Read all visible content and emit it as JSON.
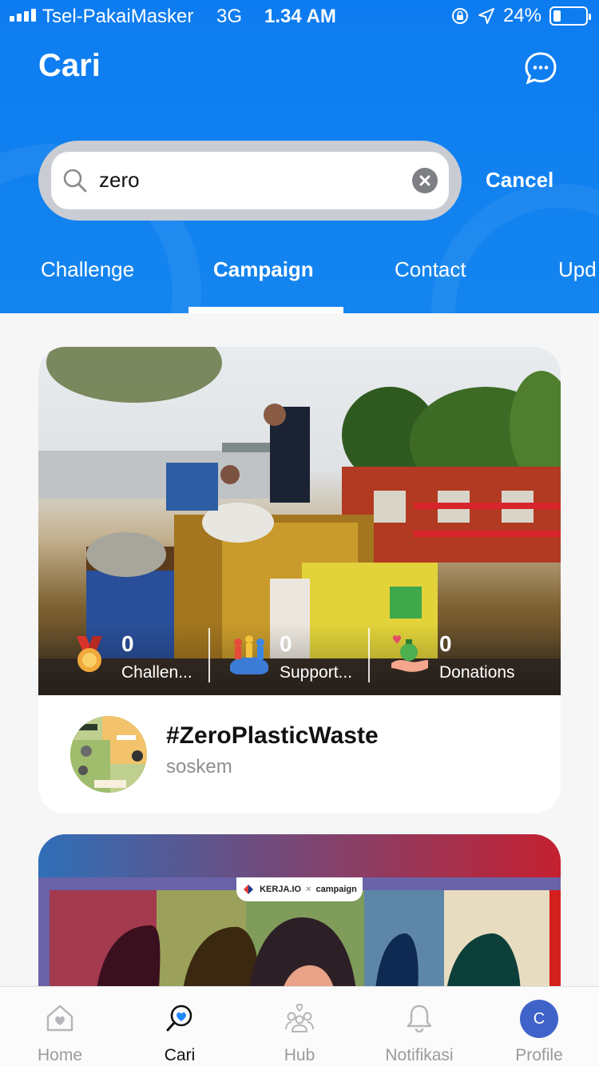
{
  "status_bar": {
    "carrier": "Tsel-PakaiMasker",
    "network": "3G",
    "time": "1.34 AM",
    "battery": "24%",
    "battery_level": 0.24,
    "icons": [
      "signal-icon",
      "rotation-lock-icon",
      "location-arrow-icon",
      "battery-icon"
    ]
  },
  "header": {
    "title": "Cari",
    "chat_icon": "chat-bubble-icon"
  },
  "search": {
    "value": "zero",
    "cancel_label": "Cancel",
    "icon": "search-icon",
    "clear_icon": "clear-icon"
  },
  "tabs": [
    {
      "label": "Challenge",
      "active": false
    },
    {
      "label": "Campaign",
      "active": true
    },
    {
      "label": "Contact",
      "active": false
    },
    {
      "label": "Upd",
      "active": false
    }
  ],
  "campaign_card": {
    "stats": [
      {
        "icon": "medal-icon",
        "value": "0",
        "label": "Challen..."
      },
      {
        "icon": "supporters-icon",
        "value": "0",
        "label": "Support..."
      },
      {
        "icon": "donations-icon",
        "value": "0",
        "label": "Donations"
      }
    ],
    "title": "#ZeroPlasticWaste",
    "author": "soskem"
  },
  "second_card": {
    "logo_left": "KERJA.IO",
    "logo_sep": "×",
    "logo_right": "campaign"
  },
  "bottom_nav": [
    {
      "label": "Home",
      "icon": "home-heart-icon",
      "active": false
    },
    {
      "label": "Cari",
      "icon": "search-heart-icon",
      "active": true
    },
    {
      "label": "Hub",
      "icon": "people-group-icon",
      "active": false
    },
    {
      "label": "Notifikasi",
      "icon": "bell-icon",
      "active": false
    },
    {
      "label": "Profile",
      "icon": "avatar",
      "active": false,
      "initial": "C"
    }
  ],
  "colors": {
    "header_blue": "#0d7cf0",
    "profile_blue": "#3f63c8",
    "active_heart": "#1e88ff"
  }
}
